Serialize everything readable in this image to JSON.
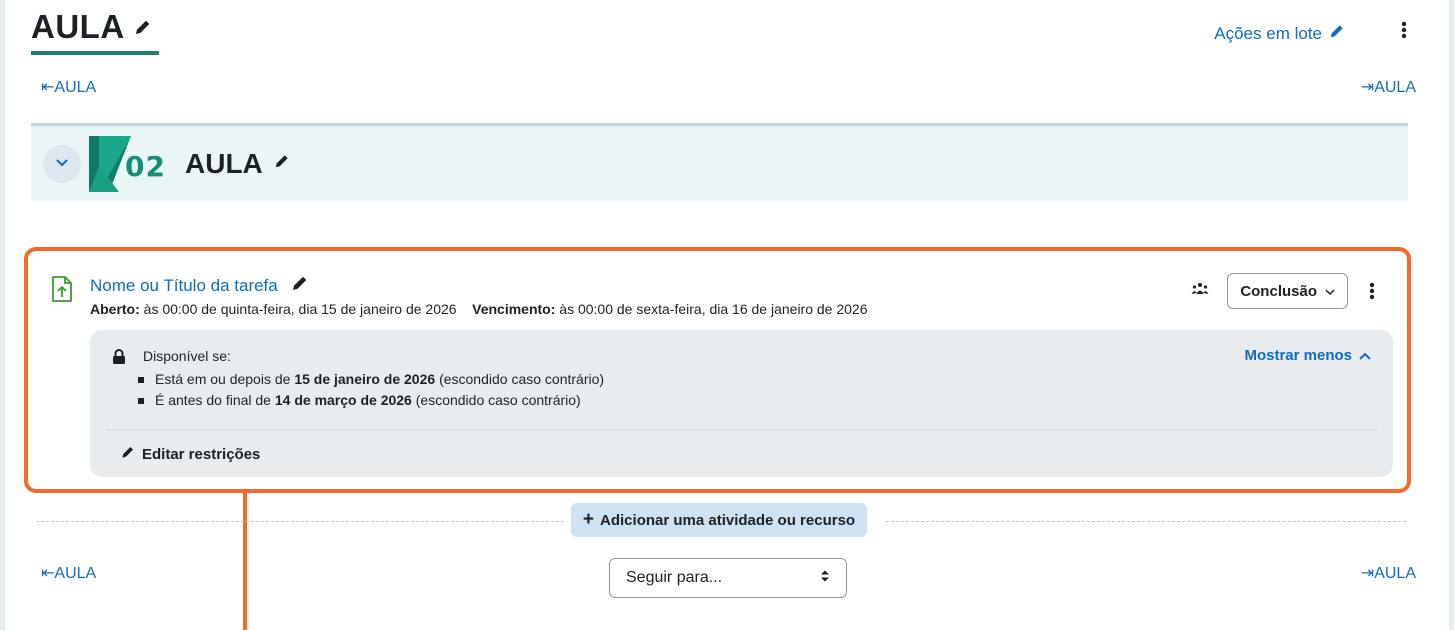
{
  "header": {
    "title": "AULA",
    "bulk_actions": "Ações em lote"
  },
  "nav": {
    "prev_top": "⇤AULA",
    "next_top": "⇥AULA",
    "prev_bottom": "⇤AULA",
    "next_bottom": "⇥AULA"
  },
  "section": {
    "logo_text": "02",
    "title": "AULA"
  },
  "activity": {
    "title": "Nome ou Título da tarefa",
    "open_label": "Aberto:",
    "open_value": "às 00:00 de quinta-feira, dia 15 de janeiro de 2026",
    "due_label": "Vencimento:",
    "due_value": "às 00:00 de sexta-feira, dia 16 de janeiro de 2026",
    "completion_label": "Conclusão"
  },
  "restrictions": {
    "available_label": "Disponível se:",
    "show_less": "Mostrar menos",
    "conditions": [
      {
        "prefix": "Está em ou depois de",
        "date": "15 de janeiro de 2026",
        "suffix": "(escondido caso contrário)"
      },
      {
        "prefix": "É antes do final de",
        "date": "14 de março de 2026",
        "suffix": "(escondido caso contrário)"
      }
    ],
    "edit_label": "Editar restrições"
  },
  "add_activity": "Adicionar uma atividade ou recurso",
  "jump_to": "Seguir para...",
  "colors": {
    "accent_link": "#0f6cbf",
    "highlight": "#f26b2d",
    "section_bg": "#eaf5f5",
    "brand_green": "#148f77"
  }
}
